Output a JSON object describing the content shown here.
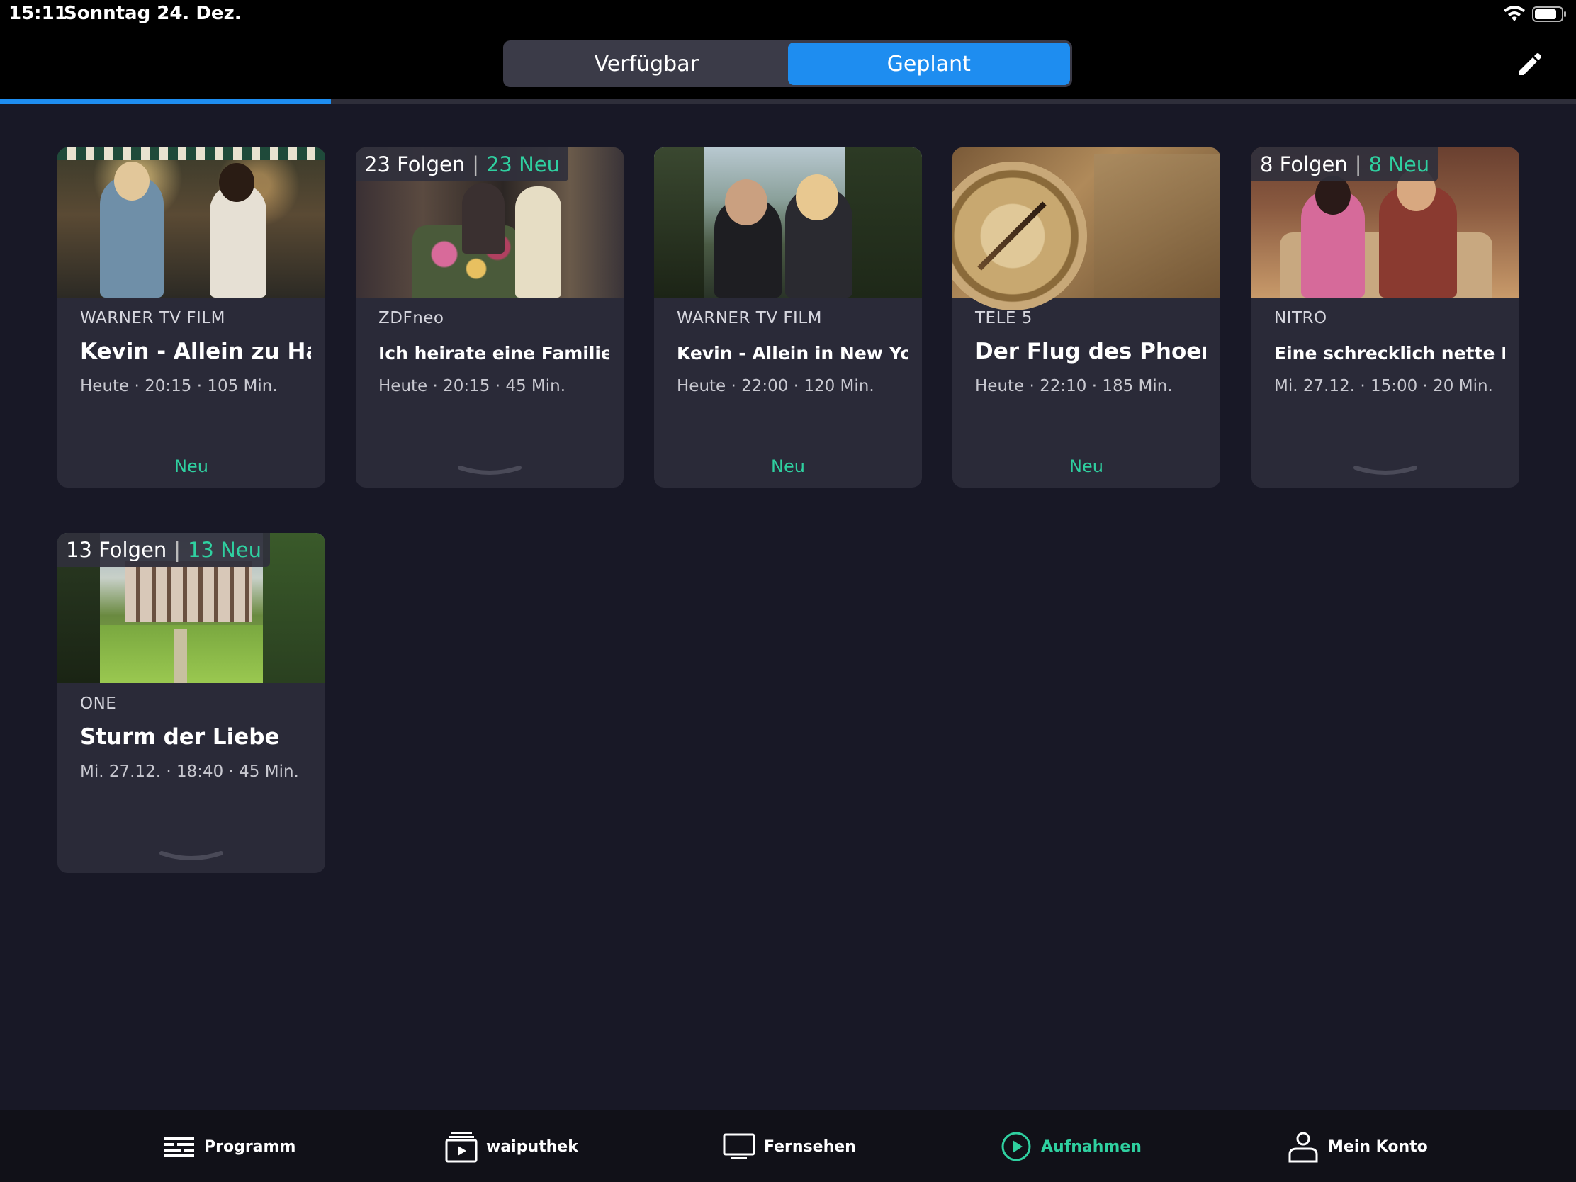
{
  "status_bar": {
    "time": "15:11",
    "date": "Sonntag 24. Dez.",
    "icons": [
      "wifi-icon",
      "battery-icon"
    ]
  },
  "header": {
    "tabs": [
      {
        "label": "Verfügbar",
        "active": false
      },
      {
        "label": "Geplant",
        "active": true
      }
    ],
    "edit_icon": "pencil-icon",
    "progress_fraction": 0.21
  },
  "colors": {
    "accent_blue": "#1e8df0",
    "accent_green": "#2fd0a0",
    "background": "#181826",
    "card": "#2a2a38"
  },
  "cards": [
    {
      "channel": "WARNER TV FILM",
      "title": "Kevin - Allein zu Haus",
      "meta": "Heute · 20:15 · 105 Min.",
      "footer": "Neu"
    },
    {
      "episodes": "23 Folgen",
      "episodes_sep": "|",
      "new_count": "23 Neu",
      "channel": "ZDFneo",
      "title": "Ich heirate eine Familie ....",
      "meta": "Heute · 20:15 · 45 Min.",
      "footer_icon": "chevron-down-icon"
    },
    {
      "channel": "WARNER TV FILM",
      "title": "Kevin - Allein in New York",
      "meta": "Heute · 22:00 · 120 Min.",
      "footer": "Neu"
    },
    {
      "channel": "TELE 5",
      "title": "Der Flug des Phoenix",
      "meta": "Heute · 22:10 · 185 Min.",
      "footer": "Neu"
    },
    {
      "episodes": "8 Folgen",
      "episodes_sep": "|",
      "new_count": "8 Neu",
      "channel": "NITRO",
      "title": "Eine schrecklich nette F...",
      "meta": "Mi. 27.12. · 15:00 · 20 Min.",
      "footer_icon": "chevron-down-icon"
    },
    {
      "episodes": "13 Folgen",
      "episodes_sep": "|",
      "new_count": "13 Neu",
      "channel": "ONE",
      "title": "Sturm der Liebe",
      "meta": "Mi. 27.12. · 18:40 · 45 Min.",
      "footer_icon": "chevron-down-icon"
    }
  ],
  "tabbar": [
    {
      "label": "Programm",
      "icon": "program-guide-icon",
      "active": false
    },
    {
      "label": "waiputhek",
      "icon": "media-library-icon",
      "active": false
    },
    {
      "label": "Fernsehen",
      "icon": "tv-icon",
      "active": false
    },
    {
      "label": "Aufnahmen",
      "icon": "play-circle-icon",
      "active": true
    },
    {
      "label": "Mein Konto",
      "icon": "user-icon",
      "active": false
    }
  ]
}
